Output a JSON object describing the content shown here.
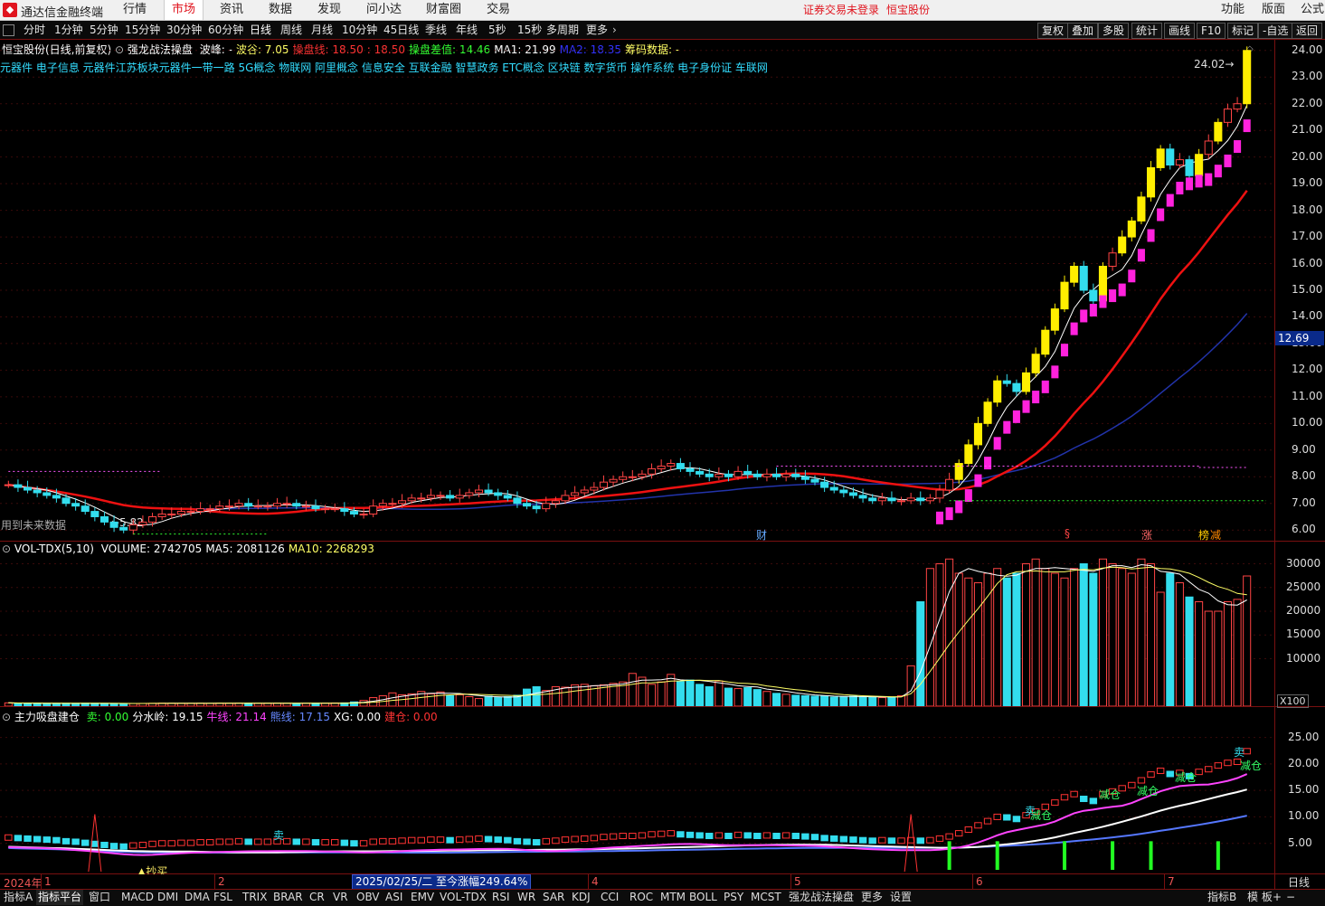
{
  "window": {
    "app_title": "通达信金融终端",
    "menu": [
      "行情",
      "市场",
      "资讯",
      "数据",
      "发现",
      "问小达",
      "财富圈",
      "交易"
    ],
    "active_menu": "市场",
    "notice": "证券交易未登录",
    "notice_stock": "恒宝股份",
    "right_menu": [
      "功能",
      "版面",
      "公式"
    ]
  },
  "periods": [
    "分时",
    "1分钟",
    "5分钟",
    "15分钟",
    "30分钟",
    "60分钟",
    "日线",
    "周线",
    "月线",
    "10分钟",
    "45日线",
    "季线",
    "年线",
    "5秒",
    "15秒",
    "多周期",
    "更多"
  ],
  "active_period": "日线",
  "right_tools": [
    "复权",
    "叠加",
    "多股",
    "统计",
    "画线",
    "F10",
    "-自选",
    "返回"
  ],
  "main": {
    "title": "恒宝股份(日线,前复权)",
    "indicator": "强龙战法操盘",
    "fields": [
      {
        "text": "波峰: -",
        "color": "#ffffff"
      },
      {
        "text": "波谷: 7.05",
        "color": "#ffff66"
      },
      {
        "text": "操盘线: 18.50",
        "color": "#ff3333"
      },
      {
        "text": ": 18.50",
        "color": "#ff3333"
      },
      {
        "text": "操盘差值: 14.46",
        "color": "#33ff33"
      },
      {
        "text": "MA1: 21.99",
        "color": "#ffffff"
      },
      {
        "text": "MA2: 18.35",
        "color": "#3333ff"
      },
      {
        "text": "筹码数据: -",
        "color": "#ffff66"
      }
    ],
    "concepts": "元器件 电子信息 元器件江苏板块元器件一带一路 5G概念 物联网 阿里概念 信息安全 互联金融 智慧政务 ETC概念 区块链 数字货币 操作系统 电子身份证 车联网",
    "future_note": "用到未来数据",
    "low_label": "5.82",
    "high_label": "24.02",
    "price_axis": [
      "24.00",
      "23.00",
      "22.00",
      "21.00",
      "20.00",
      "19.00",
      "18.00",
      "17.00",
      "16.00",
      "15.00",
      "14.00",
      "13.00",
      "12.00",
      "11.00",
      "10.00",
      "9.00",
      "8.00",
      "7.00",
      "6.00"
    ],
    "current_price": "12.69",
    "event_markers": [
      {
        "text": "财",
        "color": "#66aaff"
      },
      {
        "text": "§",
        "color": "#ff4444"
      },
      {
        "text": "涨",
        "color": "#ff6666"
      },
      {
        "text": "榜",
        "color": "#ffcc00"
      },
      {
        "text": "减",
        "color": "#ff8800"
      }
    ]
  },
  "volume": {
    "title": "VOL-TDX(5,10)",
    "fields": [
      {
        "text": "VOLUME: 2742705",
        "color": "#ffffff"
      },
      {
        "text": "MA5: 2081126",
        "color": "#ffffff"
      },
      {
        "text": "MA10: 2268293",
        "color": "#ffff66"
      }
    ],
    "axis": [
      "30000",
      "25000",
      "20000",
      "15000",
      "10000"
    ],
    "unit": "X100"
  },
  "indicator2": {
    "title": "主力吸盘建仓",
    "fields": [
      {
        "text": "卖: 0.00",
        "color": "#33ff33"
      },
      {
        "text": "分水岭: 19.15",
        "color": "#ffffff"
      },
      {
        "text": "牛线: 21.14",
        "color": "#ff44ff"
      },
      {
        "text": "熊线: 17.15",
        "color": "#6688ff"
      },
      {
        "text": "XG: 0.00",
        "color": "#ffffff"
      },
      {
        "text": "建仓: 0.00",
        "color": "#ff3333"
      }
    ],
    "axis": [
      "25.00",
      "20.00",
      "15.00",
      "10.00",
      "5.00"
    ],
    "signals": {
      "sell": "卖",
      "reduce": "减仓",
      "buy": "抄买"
    }
  },
  "date_axis": {
    "year": "2024年",
    "months": [
      "1",
      "2",
      "3",
      "4",
      "5",
      "6",
      "7"
    ],
    "tooltip": "2025/02/25/二 至今涨幅249.64%",
    "period_label": "日线"
  },
  "bottom_tabs": [
    "指标A",
    "指标平台",
    "窗口",
    "MACD",
    "DMI",
    "DMA",
    "FSL",
    "TRIX",
    "BRAR",
    "CR",
    "VR",
    "OBV",
    "ASI",
    "EMV",
    "VOL-TDX",
    "RSI",
    "WR",
    "SAR",
    "KDJ",
    "CCI",
    "ROC",
    "MTM",
    "BOLL",
    "PSY",
    "MCST",
    "强龙战法操盘",
    "更多",
    "设置"
  ],
  "bottom_right": [
    "指标B",
    "模 板",
    "+",
    "−"
  ],
  "chart_data": {
    "type": "candlestick",
    "title": "恒宝股份(日线,前复权)",
    "ylim": [
      5.6,
      24.4
    ],
    "y_ticks": [
      6,
      7,
      8,
      9,
      10,
      11,
      12,
      13,
      14,
      15,
      16,
      17,
      18,
      19,
      20,
      21,
      22,
      23,
      24
    ],
    "close": [
      7.7,
      7.6,
      7.5,
      7.4,
      7.3,
      7.2,
      7.0,
      6.9,
      6.7,
      6.5,
      6.3,
      6.1,
      6.0,
      6.2,
      6.3,
      6.5,
      6.6,
      6.6,
      6.7,
      6.7,
      6.8,
      6.8,
      6.9,
      6.9,
      7.0,
      6.9,
      6.9,
      6.9,
      7.0,
      7.0,
      6.9,
      6.9,
      6.8,
      6.8,
      6.8,
      6.7,
      6.6,
      6.6,
      6.9,
      7.0,
      7.0,
      7.1,
      7.2,
      7.2,
      7.3,
      7.3,
      7.2,
      7.3,
      7.4,
      7.5,
      7.4,
      7.3,
      7.2,
      7.0,
      6.9,
      6.8,
      7.0,
      7.1,
      7.3,
      7.4,
      7.5,
      7.6,
      7.8,
      7.9,
      8.0,
      8.0,
      8.1,
      8.3,
      8.4,
      8.5,
      8.3,
      8.2,
      8.1,
      8.0,
      8.1,
      8.0,
      8.2,
      8.1,
      8.0,
      8.1,
      8.0,
      8.1,
      8.0,
      7.9,
      7.8,
      7.6,
      7.5,
      7.4,
      7.3,
      7.2,
      7.1,
      7.2,
      7.1,
      7.1,
      7.2,
      7.1,
      7.2,
      7.5,
      7.9,
      8.5,
      9.2,
      10.0,
      10.8,
      11.6,
      11.5,
      11.2,
      11.9,
      12.6,
      13.5,
      14.3,
      15.3,
      15.9,
      15.0,
      14.6,
      15.9,
      16.4,
      17.0,
      17.6,
      18.5,
      19.6,
      20.3,
      19.7,
      19.9,
      19.3,
      20.1,
      20.6,
      21.3,
      21.8,
      22.0,
      24.0
    ],
    "volume": [
      700,
      650,
      600,
      620,
      580,
      560,
      600,
      590,
      620,
      600,
      580,
      560,
      540,
      560,
      580,
      600,
      640,
      620,
      600,
      600,
      620,
      580,
      620,
      600,
      640,
      620,
      600,
      620,
      640,
      600,
      580,
      600,
      620,
      640,
      680,
      700,
      900,
      1200,
      1800,
      2200,
      2800,
      2400,
      2600,
      3100,
      2600,
      3000,
      2200,
      2400,
      2000,
      1600,
      2100,
      1800,
      2000,
      2300,
      3600,
      4100,
      3300,
      4100,
      4000,
      4500,
      4600,
      4300,
      4500,
      4800,
      5100,
      6900,
      6100,
      4600,
      5100,
      6700,
      5200,
      5500,
      4600,
      4100,
      5300,
      3800,
      3700,
      3900,
      3500,
      3100,
      2700,
      2500,
      2300,
      2200,
      2100,
      2100,
      1900,
      2000,
      2100,
      2000,
      1900,
      1800,
      1800,
      2200,
      8500,
      22000,
      29000,
      30000,
      31000,
      28000,
      27000,
      26000,
      28000,
      29000,
      27000,
      28000,
      30000,
      31000,
      29000,
      28000,
      27000,
      29000,
      30000,
      28000,
      31000,
      30000,
      29000,
      28000,
      31000,
      30000,
      24000,
      28000,
      26000,
      23000,
      22000,
      20000,
      20000,
      22000,
      22500,
      27427
    ],
    "volume_ma5_last": 20811.26,
    "volume_ma10_last": 22682.93,
    "volume_unit": "X100",
    "volume_ylim": [
      0,
      32000
    ],
    "indicator2_ylim": [
      0,
      28
    ]
  }
}
